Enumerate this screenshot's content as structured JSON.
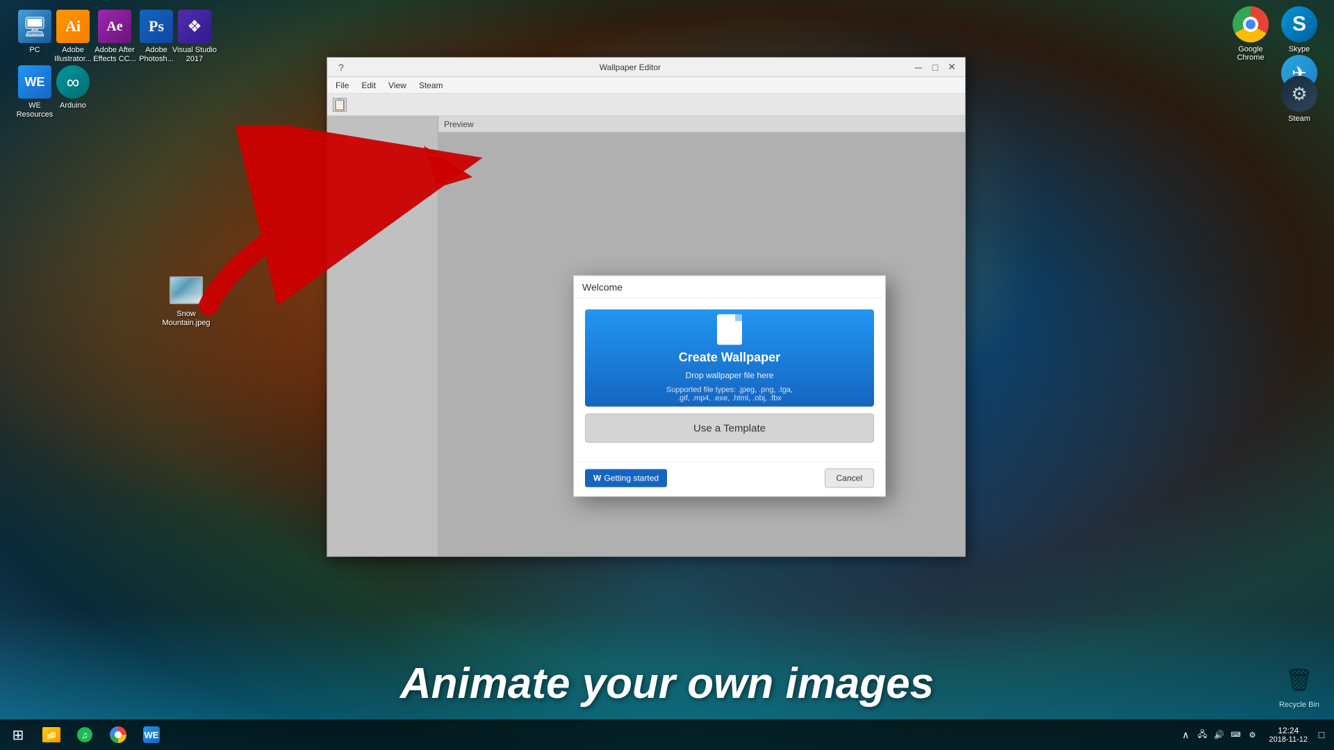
{
  "desktop": {
    "background_description": "Space nebula with orange and blue colors"
  },
  "icons": {
    "pc": {
      "label": "PC"
    },
    "illustrator": {
      "label": "Adobe Illustrator..."
    },
    "aftereffects": {
      "label": "Adobe After Effects CC..."
    },
    "photoshop": {
      "label": "Adobe Photosh..."
    },
    "vstudio": {
      "label": "Visual Studio 2017"
    },
    "weresources": {
      "label": "WE Resources"
    },
    "arduino": {
      "label": "Arduino"
    },
    "snow_mountain": {
      "label": "Snow Mountain.jpeg"
    },
    "skype": {
      "label": "Skype"
    },
    "telegram": {
      "label": "Telegram"
    },
    "chrome": {
      "label": "Google Chrome"
    },
    "steam": {
      "label": "Steam"
    },
    "recycle_bin": {
      "label": "Recycle Bin"
    }
  },
  "we_window": {
    "title": "Wallpaper Editor",
    "menu": {
      "file": "File",
      "edit": "Edit",
      "view": "View",
      "steam": "Steam"
    },
    "preview_label": "Preview"
  },
  "welcome_dialog": {
    "title": "Welcome",
    "create_wallpaper_label": "Create Wallpaper",
    "drop_text": "Drop wallpaper file here",
    "supported_text": "Supported file types: .jpeg, .png, .tga,",
    "supported_text2": ".gif, .mp4, .exe, .html, .obj, .fbx",
    "use_template_label": "Use a Template",
    "getting_started_label": "Getting started",
    "cancel_label": "Cancel"
  },
  "bottom_text": "Animate your own images",
  "taskbar": {
    "time": "12:24",
    "date": "2018-11-12"
  }
}
